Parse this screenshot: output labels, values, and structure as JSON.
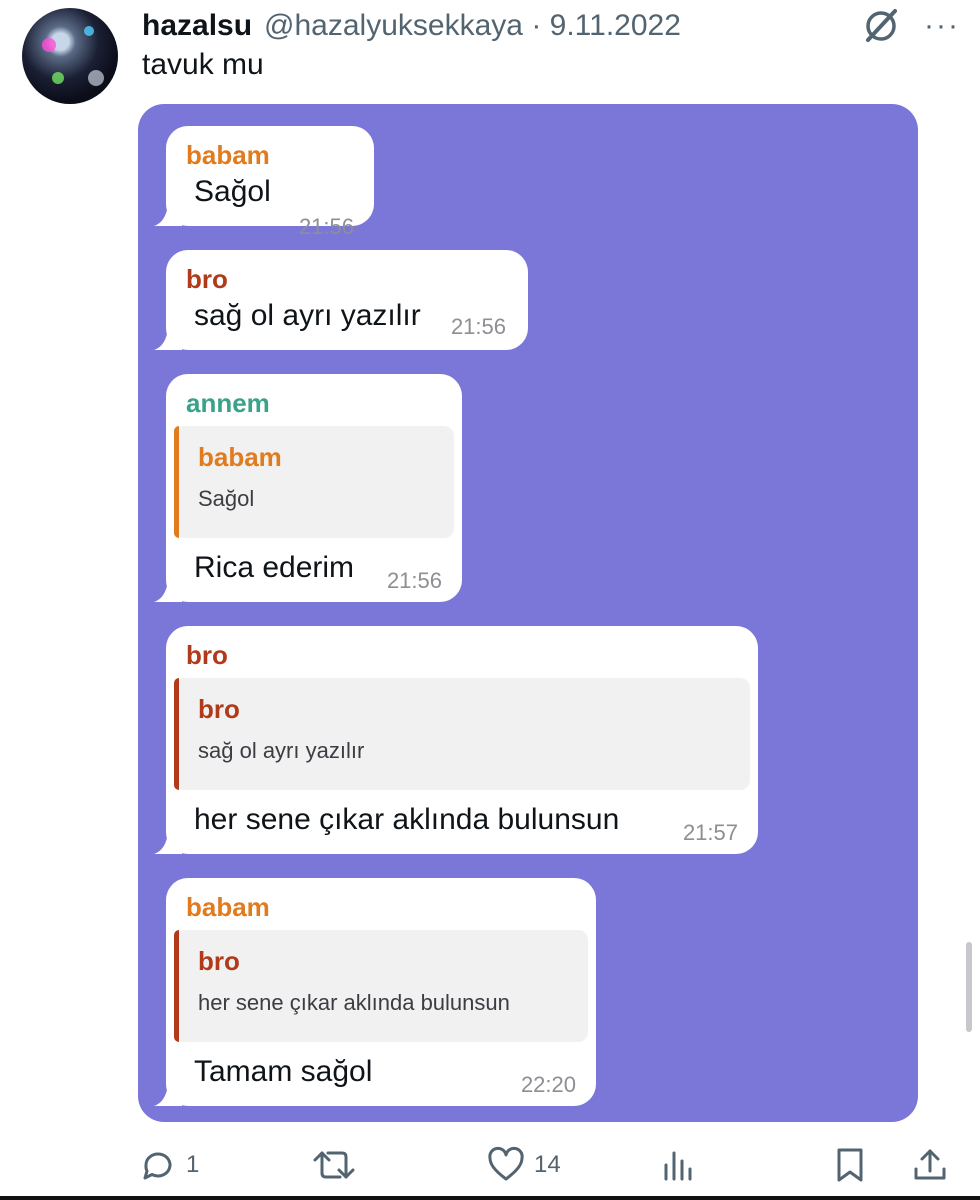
{
  "tweet": {
    "display_name": "hazalsu",
    "handle": "@hazalyuksekkaya",
    "separator": "·",
    "date": "9.11.2022",
    "text": "tavuk mu",
    "avatar_icon": "profile-avatar",
    "header_icons": [
      "grok-icon",
      "more-options-icon"
    ],
    "more_label": "···"
  },
  "chat": {
    "background": "#7a77d8",
    "messages": [
      {
        "sender": "babam",
        "sender_color": "#e07b1f",
        "text": "Sağol",
        "time": "21:56"
      },
      {
        "sender": "bro",
        "sender_color": "#b03a1a",
        "text": "sağ ol ayrı yazılır",
        "time": "21:56"
      },
      {
        "sender": "annem",
        "sender_color": "#3aa18a",
        "reply_to": {
          "sender": "babam",
          "text": "Sağol",
          "color": "#e07b1f"
        },
        "text": "Rica ederim",
        "time": "21:56"
      },
      {
        "sender": "bro",
        "sender_color": "#b03a1a",
        "reply_to": {
          "sender": "bro",
          "text": "sağ ol ayrı yazılır",
          "color": "#b03a1a"
        },
        "text": "her sene çıkar aklında bulunsun",
        "time": "21:57"
      },
      {
        "sender": "babam",
        "sender_color": "#e07b1f",
        "reply_to": {
          "sender": "bro",
          "text": "her sene çıkar aklında bulunsun",
          "color": "#b03a1a"
        },
        "text": "Tamam sağol",
        "time": "22:20"
      }
    ]
  },
  "actions": {
    "reply_count": "1",
    "retweet_count": "",
    "like_count": "14",
    "icons": [
      "reply-icon",
      "retweet-icon",
      "like-icon",
      "views-icon",
      "bookmark-icon",
      "share-icon"
    ]
  }
}
